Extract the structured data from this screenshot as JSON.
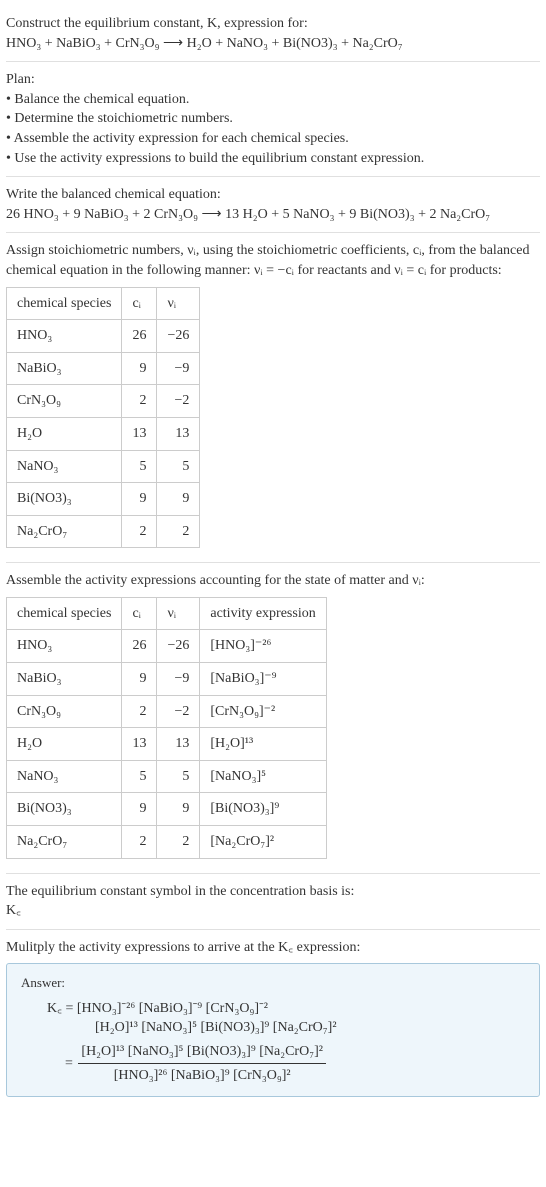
{
  "q_line1": "Construct the equilibrium constant, K, expression for:",
  "q_reaction": "HNO₃ + NaBiO₃ + CrN₃O₉  ⟶  H₂O + NaNO₃ + Bi(NO3)₃ + Na₂CrO₇",
  "plan_title": "Plan:",
  "plan_items": [
    "• Balance the chemical equation.",
    "• Determine the stoichiometric numbers.",
    "• Assemble the activity expression for each chemical species.",
    "• Use the activity expressions to build the equilibrium constant expression."
  ],
  "balanced_title": "Write the balanced chemical equation:",
  "balanced_reaction": "26 HNO₃ + 9 NaBiO₃ + 2 CrN₃O₉  ⟶  13 H₂O + 5 NaNO₃ + 9 Bi(NO3)₃ + 2 Na₂CrO₇",
  "assign_text": "Assign stoichiometric numbers, νᵢ, using the stoichiometric coefficients, cᵢ, from the balanced chemical equation in the following manner: νᵢ = −cᵢ for reactants and νᵢ = cᵢ for products:",
  "t1_headers": {
    "species": "chemical species",
    "ci": "cᵢ",
    "vi": "νᵢ"
  },
  "t1_rows": [
    {
      "sp": "HNO₃",
      "c": "26",
      "v": "−26"
    },
    {
      "sp": "NaBiO₃",
      "c": "9",
      "v": "−9"
    },
    {
      "sp": "CrN₃O₉",
      "c": "2",
      "v": "−2"
    },
    {
      "sp": "H₂O",
      "c": "13",
      "v": "13"
    },
    {
      "sp": "NaNO₃",
      "c": "5",
      "v": "5"
    },
    {
      "sp": "Bi(NO3)₃",
      "c": "9",
      "v": "9"
    },
    {
      "sp": "Na₂CrO₇",
      "c": "2",
      "v": "2"
    }
  ],
  "assemble_text": "Assemble the activity expressions accounting for the state of matter and νᵢ:",
  "t2_headers": {
    "species": "chemical species",
    "ci": "cᵢ",
    "vi": "νᵢ",
    "act": "activity expression"
  },
  "t2_rows": [
    {
      "sp": "HNO₃",
      "c": "26",
      "v": "−26",
      "a": "[HNO₃]⁻²⁶"
    },
    {
      "sp": "NaBiO₃",
      "c": "9",
      "v": "−9",
      "a": "[NaBiO₃]⁻⁹"
    },
    {
      "sp": "CrN₃O₉",
      "c": "2",
      "v": "−2",
      "a": "[CrN₃O₉]⁻²"
    },
    {
      "sp": "H₂O",
      "c": "13",
      "v": "13",
      "a": "[H₂O]¹³"
    },
    {
      "sp": "NaNO₃",
      "c": "5",
      "v": "5",
      "a": "[NaNO₃]⁵"
    },
    {
      "sp": "Bi(NO3)₃",
      "c": "9",
      "v": "9",
      "a": "[Bi(NO3)₃]⁹"
    },
    {
      "sp": "Na₂CrO₇",
      "c": "2",
      "v": "2",
      "a": "[Na₂CrO₇]²"
    }
  ],
  "kc_basis_text": "The equilibrium constant symbol in the concentration basis is:",
  "kc_symbol": "K꜀",
  "multiply_text": "Mulitply the activity expressions to arrive at the K꜀ expression:",
  "answer_label": "Answer:",
  "ans_line1": "K꜀ = [HNO₃]⁻²⁶ [NaBiO₃]⁻⁹ [CrN₃O₉]⁻²",
  "ans_line2": "[H₂O]¹³ [NaNO₃]⁵ [Bi(NO3)₃]⁹ [Na₂CrO₇]²",
  "ans_eq": "=",
  "ans_frac_num": "[H₂O]¹³ [NaNO₃]⁵ [Bi(NO3)₃]⁹ [Na₂CrO₇]²",
  "ans_frac_den": "[HNO₃]²⁶ [NaBiO₃]⁹ [CrN₃O₉]²"
}
